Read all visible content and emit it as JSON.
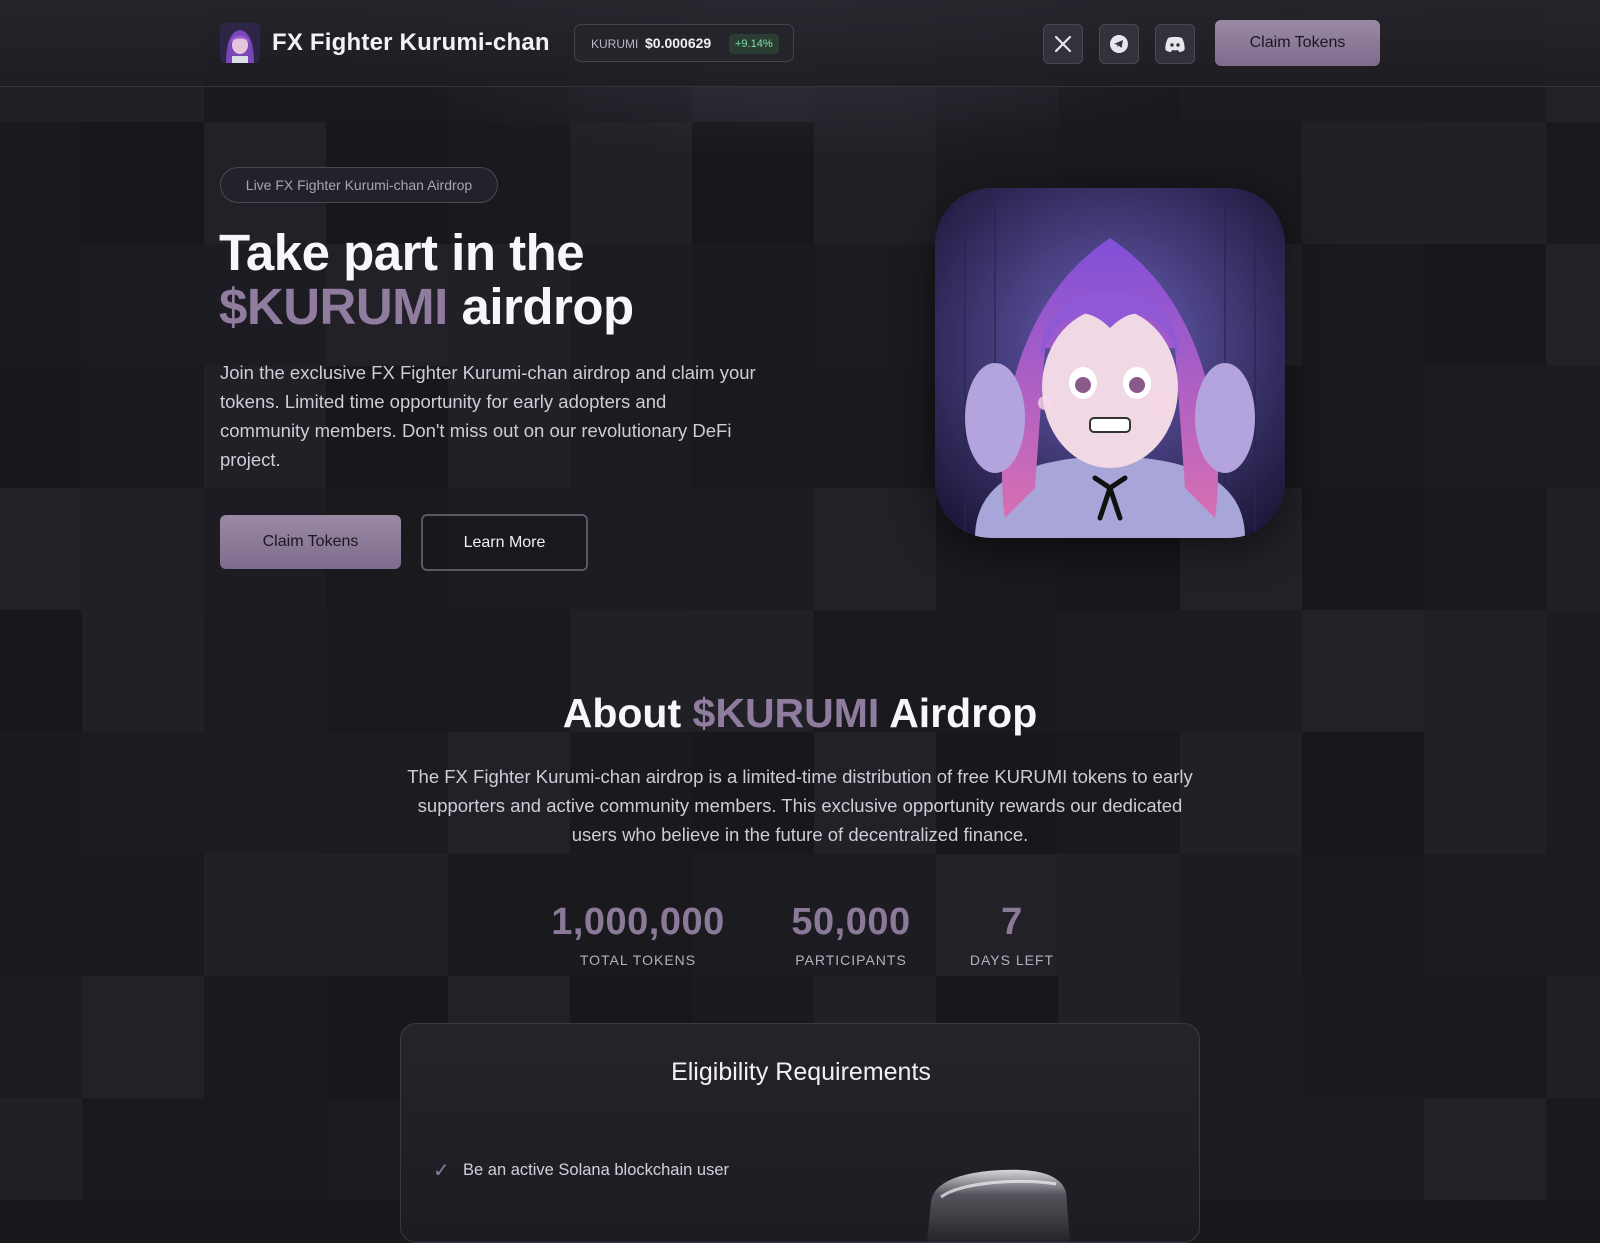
{
  "header": {
    "brand": "FX Fighter Kurumi-chan",
    "ticker": {
      "symbol": "KURUMI",
      "price": "$0.000629",
      "change": "+9.14%",
      "change_color": "#7ee0a6"
    },
    "social": [
      "x-icon",
      "telegram-icon",
      "discord-icon"
    ],
    "cta": "Claim Tokens"
  },
  "hero": {
    "badge": "Live FX Fighter Kurumi-chan Airdrop",
    "title_line1": "Take part in the",
    "title_accent": "$KURUMI",
    "title_rest": " airdrop",
    "description": "Join the exclusive FX Fighter Kurumi-chan airdrop and claim your tokens. Limited time opportunity for early adopters and community members. Don't miss out on our revolutionary DeFi project.",
    "primary_button": "Claim Tokens",
    "secondary_button": "Learn More"
  },
  "about": {
    "title_pre": "About ",
    "title_accent": "$KURUMI",
    "title_post": " Airdrop",
    "description": "The FX Fighter Kurumi-chan airdrop is a limited-time distribution of free KURUMI tokens to early supporters and active community members. This exclusive opportunity rewards our dedicated users who believe in the future of decentralized finance.",
    "stats": [
      {
        "value": "1,000,000",
        "label": "TOTAL TOKENS"
      },
      {
        "value": "50,000",
        "label": "PARTICIPANTS"
      },
      {
        "value": "7",
        "label": "DAYS LEFT"
      }
    ]
  },
  "eligibility": {
    "title": "Eligibility Requirements",
    "items": [
      {
        "check": "✓",
        "text": "Be an active Solana blockchain user"
      }
    ]
  },
  "colors": {
    "accent": "#8f7c9e",
    "background": "#17171c",
    "button": "#8e7d9a"
  }
}
